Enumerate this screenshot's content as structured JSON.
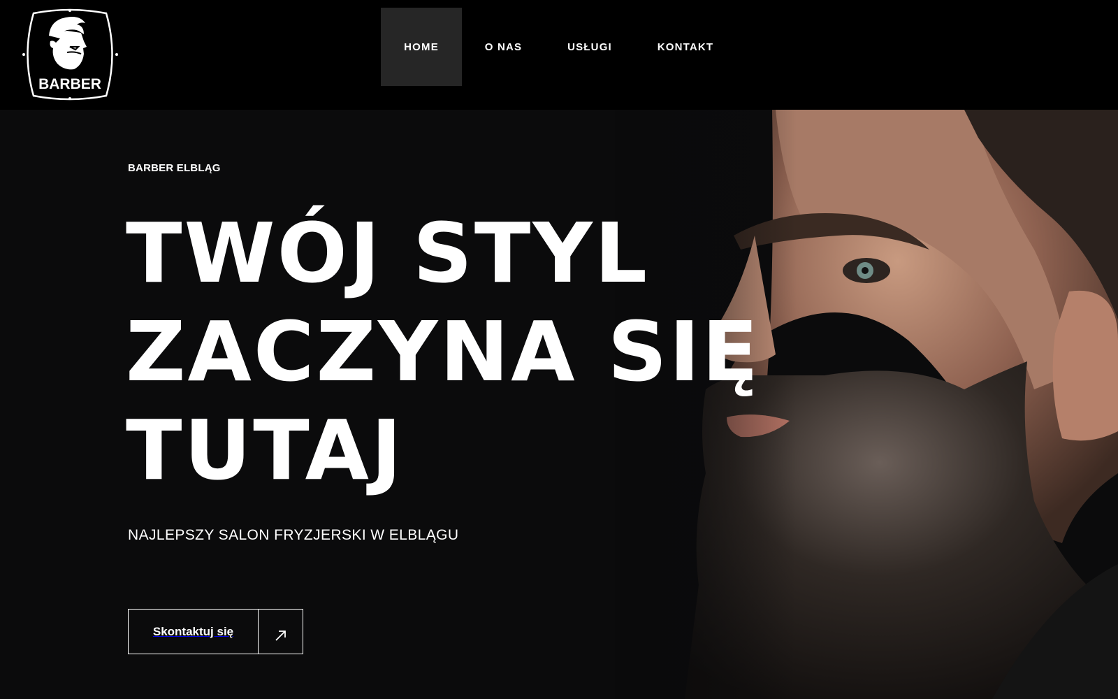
{
  "logo": {
    "text": "BARBER",
    "icon": "bearded-man-head-logo"
  },
  "nav": {
    "items": [
      {
        "label": "HOME",
        "active": true
      },
      {
        "label": "O NAS",
        "active": false
      },
      {
        "label": "USŁUGI",
        "active": false
      },
      {
        "label": "KONTAKT",
        "active": false
      }
    ]
  },
  "hero": {
    "eyebrow": "BARBER ELBLĄG",
    "headline_lines": [
      "TWÓJ STYL",
      "ZACZYNA SIĘ",
      "TUTAJ"
    ],
    "subline": "NAJLEPSZY SALON FRYZJERSKI W ELBLĄGU",
    "cta": {
      "label": "Skontaktuj się",
      "icon": "arrow-up-right-icon"
    },
    "image": "bearded-man-profile-portrait"
  },
  "colors": {
    "background": "#000000",
    "nav_active_bg": "#262626",
    "text": "#ffffff"
  }
}
